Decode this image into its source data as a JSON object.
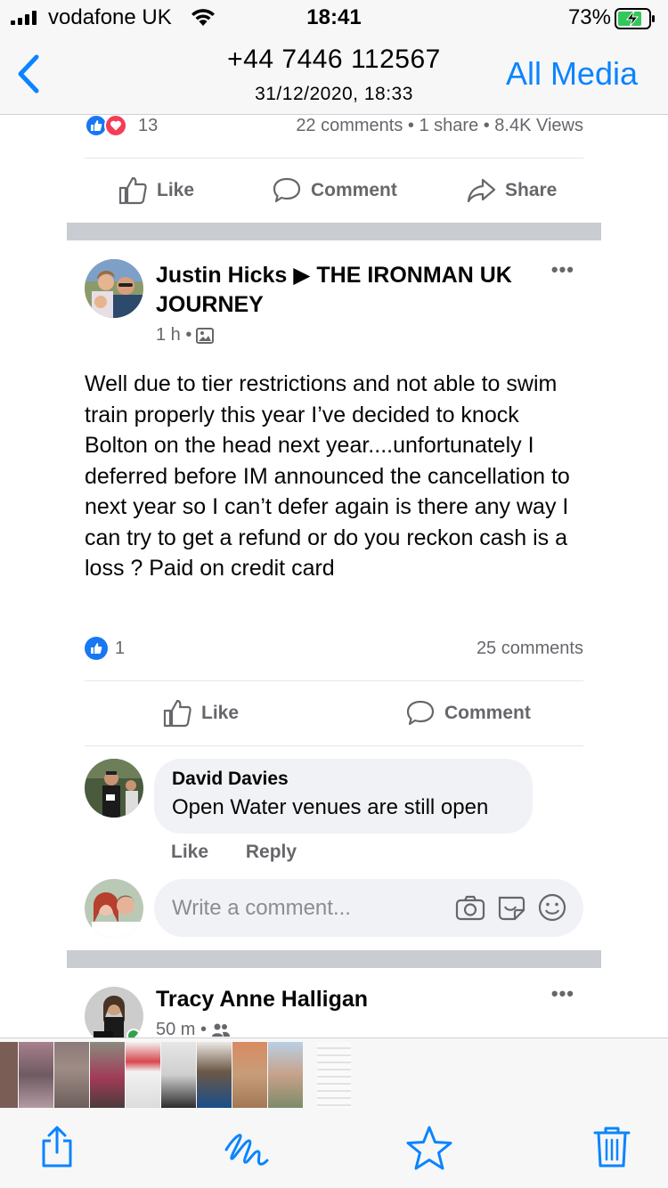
{
  "status_bar": {
    "carrier": "vodafone UK",
    "time": "18:41",
    "battery": "73%"
  },
  "nav": {
    "title": "+44 7446 112567",
    "subtitle": "31/12/2020, 18:33",
    "right_action": "All Media"
  },
  "post1": {
    "reaction_count": "13",
    "stats": "22 comments • 1 share • 8.4K Views",
    "actions": {
      "like": "Like",
      "comment": "Comment",
      "share": "Share"
    }
  },
  "post2": {
    "author": "Justin Hicks ▶ THE IRONMAN UK JOURNEY",
    "time": "1 h •",
    "more": "•••",
    "body": "Well due to tier restrictions and not able to swim train properly this year I’ve decided to knock Bolton on the head next year....unfortunately I deferred before IM announced the cancellation to next year so I can’t defer again is there any way I can try to get a refund or do you reckon cash is a loss ? Paid on credit card",
    "reaction_count": "1",
    "comments_count": "25 comments",
    "actions": {
      "like": "Like",
      "comment": "Comment"
    },
    "comment": {
      "name": "David Davies",
      "text": "Open Water venues are still open",
      "like": "Like",
      "reply": "Reply"
    },
    "write_placeholder": "Write a comment..."
  },
  "post3": {
    "author": "Tracy Anne Halligan",
    "time": "50 m •",
    "more": "•••"
  },
  "colors": {
    "accent": "#0a84ff",
    "facebook_blue": "#1877f2",
    "love_red": "#f33e58"
  },
  "icons": [
    "signal-icon",
    "wifi-icon",
    "battery-icon",
    "back-chevron-icon",
    "like-icon",
    "comment-icon",
    "share-icon",
    "photo-icon",
    "camera-icon",
    "sticker-icon",
    "emoji-icon",
    "friends-icon",
    "upload-icon",
    "markup-icon",
    "star-icon",
    "trash-icon"
  ]
}
